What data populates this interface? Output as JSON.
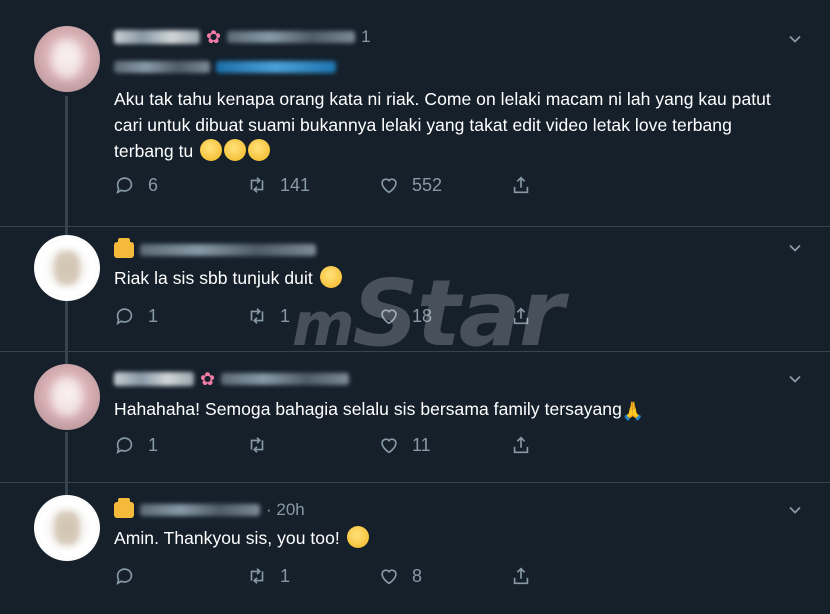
{
  "tweets": [
    {
      "time_suffix": "1",
      "text": "Aku tak tahu kenapa orang kata ni riak. Come on lelaki macam ni lah yang kau patut cari untuk dibuat suami bukannya lelaki yang takat edit video letak love terbang terbang tu",
      "replies": "6",
      "retweets": "141",
      "likes": "552"
    },
    {
      "time_suffix": "",
      "text": "Riak la sis sbb tunjuk duit",
      "replies": "1",
      "retweets": "1",
      "likes": "18"
    },
    {
      "time_suffix": "",
      "text": "Hahahaha! Semoga bahagia selalu sis bersama family tersayang",
      "replies": "1",
      "retweets": "",
      "likes": "11"
    },
    {
      "time_suffix": "· 20h",
      "text": "Amin. Thankyou sis, you too!",
      "replies": "",
      "retweets": "1",
      "likes": "8"
    }
  ],
  "watermark": {
    "m": "m",
    "rest": "Star"
  },
  "colors": {
    "background": "#15202b",
    "text": "#ffffff",
    "muted": "#8899a6",
    "divider": "#38444d"
  },
  "icons": [
    "reply-icon",
    "retweet-icon",
    "like-icon",
    "share-icon",
    "chevron-down-icon",
    "flower-emoji",
    "rolling-eyes-emoji",
    "face-with-hand-over-mouth-emoji",
    "folded-hands-emoji",
    "kissing-heart-emoji",
    "briefcase-emoji"
  ]
}
